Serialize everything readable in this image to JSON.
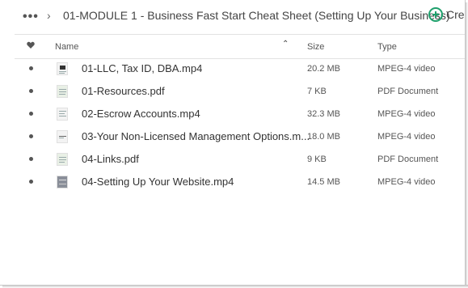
{
  "header": {
    "more_icon": "more-horizontal-icon",
    "breadcrumb_separator_icon": "chevron-right-icon",
    "folder_title": "01-MODULE 1 - Business Fast Start Cheat Sheet (Setting Up Your Business)",
    "create_label": "Cre",
    "create_icon": "plus-circle-icon",
    "accent_color": "#1fa06c"
  },
  "columns": {
    "favorite_icon": "heart-icon",
    "name": "Name",
    "sort_icon": "caret-up-icon",
    "size": "Size",
    "type": "Type"
  },
  "files": [
    {
      "name": "01-LLC, Tax ID, DBA.mp4",
      "size": "20.2 MB",
      "type": "MPEG-4 video",
      "thumb": "video"
    },
    {
      "name": "01-Resources.pdf",
      "size": "7 KB",
      "type": "PDF Document",
      "thumb": "pdf"
    },
    {
      "name": "02-Escrow Accounts.mp4",
      "size": "32.3 MB",
      "type": "MPEG-4 video",
      "thumb": "video"
    },
    {
      "name": "03-Your Non-Licensed Management Options.m...",
      "size": "18.0 MB",
      "type": "MPEG-4 video",
      "thumb": "video"
    },
    {
      "name": "04-Links.pdf",
      "size": "9 KB",
      "type": "PDF Document",
      "thumb": "pdf"
    },
    {
      "name": "04-Setting Up Your Website.mp4",
      "size": "14.5 MB",
      "type": "MPEG-4 video",
      "thumb": "video"
    }
  ]
}
